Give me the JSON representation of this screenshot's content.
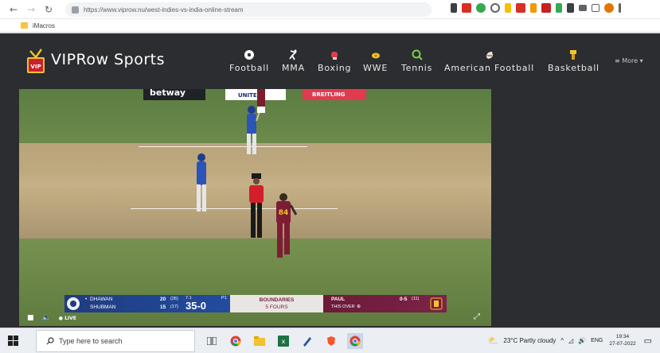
{
  "browser": {
    "url": "https://www.viprow.nu/west-indies-vs-india-online-stream",
    "bookmark_label": "iMacros"
  },
  "site": {
    "brand": "VIPRow Sports",
    "nav": [
      {
        "label": "Football",
        "icon": "football-icon"
      },
      {
        "label": "MMA",
        "icon": "mma-icon"
      },
      {
        "label": "Boxing",
        "icon": "boxing-glove-icon"
      },
      {
        "label": "WWE",
        "icon": "wwe-icon"
      },
      {
        "label": "Tennis",
        "icon": "tennis-icon"
      },
      {
        "label": "American Football",
        "icon": "american-football-icon"
      },
      {
        "label": "Basketball",
        "icon": "basketball-icon"
      }
    ],
    "more_label": "More"
  },
  "stream": {
    "ads": [
      "betway",
      "UNITED",
      "BREITLING"
    ],
    "player_number": "84",
    "live_label": "LIVE"
  },
  "scorebar": {
    "batter1": "DHAWAN",
    "batter1_score": "20",
    "batter1_balls": "(26)",
    "batter2": "SHUBMAN",
    "batter2_score": "15",
    "batter2_balls": "(17)",
    "overs": "7.1",
    "score": "35-0",
    "innings": "P1",
    "mid_title": "BOUNDARIES",
    "mid_value": "5 FOURS",
    "bowler": "PAUL",
    "bowler_figures": "0-5",
    "bowler_balls": "(11)",
    "this_over": "THIS OVER"
  },
  "taskbar": {
    "search_placeholder": "Type here to search",
    "weather": "23°C  Partly cloudy",
    "lang": "ENG",
    "time": "19:34",
    "date": "27-07-2022"
  }
}
